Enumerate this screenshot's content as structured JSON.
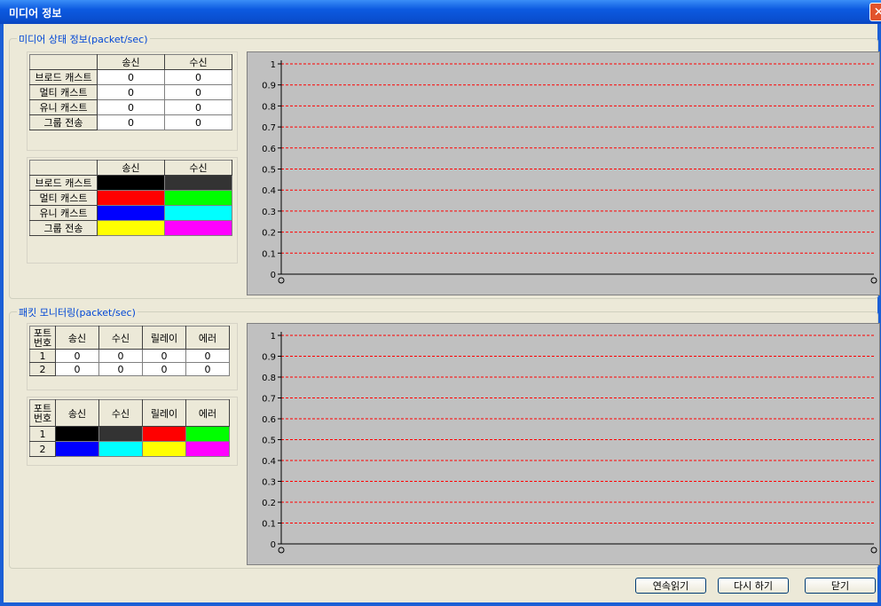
{
  "window": {
    "title": "미디어 정보",
    "close_label": "✕"
  },
  "media": {
    "group_title": "미디어 상태 정보(packet/sec)",
    "headers": [
      "",
      "송신",
      "수신"
    ],
    "rows": [
      {
        "label": "브로드 캐스트",
        "send": "0",
        "recv": "0"
      },
      {
        "label": "멀티 캐스트",
        "send": "0",
        "recv": "0"
      },
      {
        "label": "유니 캐스트",
        "send": "0",
        "recv": "0"
      },
      {
        "label": "그룹 전송",
        "send": "0",
        "recv": "0"
      }
    ],
    "color_rows": [
      {
        "label": "브로드 캐스트",
        "send_color": "#000000",
        "recv_color": "#333333"
      },
      {
        "label": "멀티 캐스트",
        "send_color": "#ff0000",
        "recv_color": "#00ff00"
      },
      {
        "label": "유니 캐스트",
        "send_color": "#0000ff",
        "recv_color": "#00ffff"
      },
      {
        "label": "그룹 전송",
        "send_color": "#ffff00",
        "recv_color": "#ff00ff"
      }
    ]
  },
  "packet": {
    "group_title": "패킷 모니터링(packet/sec)",
    "port_header": "포트\n번호",
    "headers": [
      "송신",
      "수신",
      "릴레이",
      "에러"
    ],
    "rows": [
      {
        "port": "1",
        "values": [
          "0",
          "0",
          "0",
          "0"
        ]
      },
      {
        "port": "2",
        "values": [
          "0",
          "0",
          "0",
          "0"
        ]
      }
    ],
    "color_rows": [
      {
        "port": "1",
        "colors": [
          "#000000",
          "#333333",
          "#ff0000",
          "#00ff00"
        ]
      },
      {
        "port": "2",
        "colors": [
          "#0000ff",
          "#00ffff",
          "#ffff00",
          "#ff00ff"
        ]
      }
    ]
  },
  "chart_data": [
    {
      "type": "line",
      "y_ticks": [
        "1",
        "0.9",
        "0.8",
        "0.7",
        "0.6",
        "0.5",
        "0.4",
        "0.3",
        "0.2",
        "0.1",
        "0"
      ],
      "ylim": [
        0,
        1
      ],
      "grid": true,
      "grid_color": "#ff0000",
      "series": []
    },
    {
      "type": "line",
      "y_ticks": [
        "1",
        "0.9",
        "0.8",
        "0.7",
        "0.6",
        "0.5",
        "0.4",
        "0.3",
        "0.2",
        "0.1",
        "0"
      ],
      "ylim": [
        0,
        1
      ],
      "grid": true,
      "grid_color": "#ff0000",
      "series": []
    }
  ],
  "buttons": {
    "continuous_read": "연속읽기",
    "retry": "다시 하기",
    "close": "닫기"
  }
}
